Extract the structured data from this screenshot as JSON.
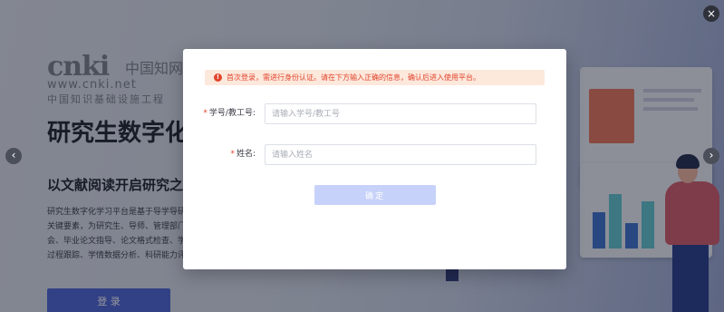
{
  "landing": {
    "logo": {
      "main": "cnki",
      "cn": "中国知网",
      "url": "www.cnki.net",
      "subtitle": "中国知识基础设施工程"
    },
    "hero_title": "研究生数字化学习平台",
    "hero_subtitle": "以文献阅读开启研究之旅",
    "hero_desc": [
      "研究生数字化学习平台是基于导学导研",
      "关键要素，为研究生、导师、管理部门",
      "会、毕业论文指导、论文格式检查、学",
      "过程跟踪、学情数据分析、科研能力评"
    ],
    "login_label": "登 录",
    "prev_arrow": "‹",
    "next_arrow": "›"
  },
  "close_label": "×",
  "modal": {
    "notice_icon": "!",
    "notice": "首次登录，需进行身份认证。请在下方输入正确的信息，确认后进入使用平台。",
    "fields": [
      {
        "label": "学号/教工号:",
        "required_mark": "*",
        "placeholder": "请输入学号/教工号",
        "value": ""
      },
      {
        "label": "姓名:",
        "required_mark": "*",
        "placeholder": "请输入姓名",
        "value": ""
      }
    ],
    "confirm_label": "确定"
  },
  "colors": {
    "primary": "#4c62d6",
    "confirm_disabled": "#c7d2fa",
    "warning": "#e2452c",
    "warning_bg": "#fde8dc"
  }
}
